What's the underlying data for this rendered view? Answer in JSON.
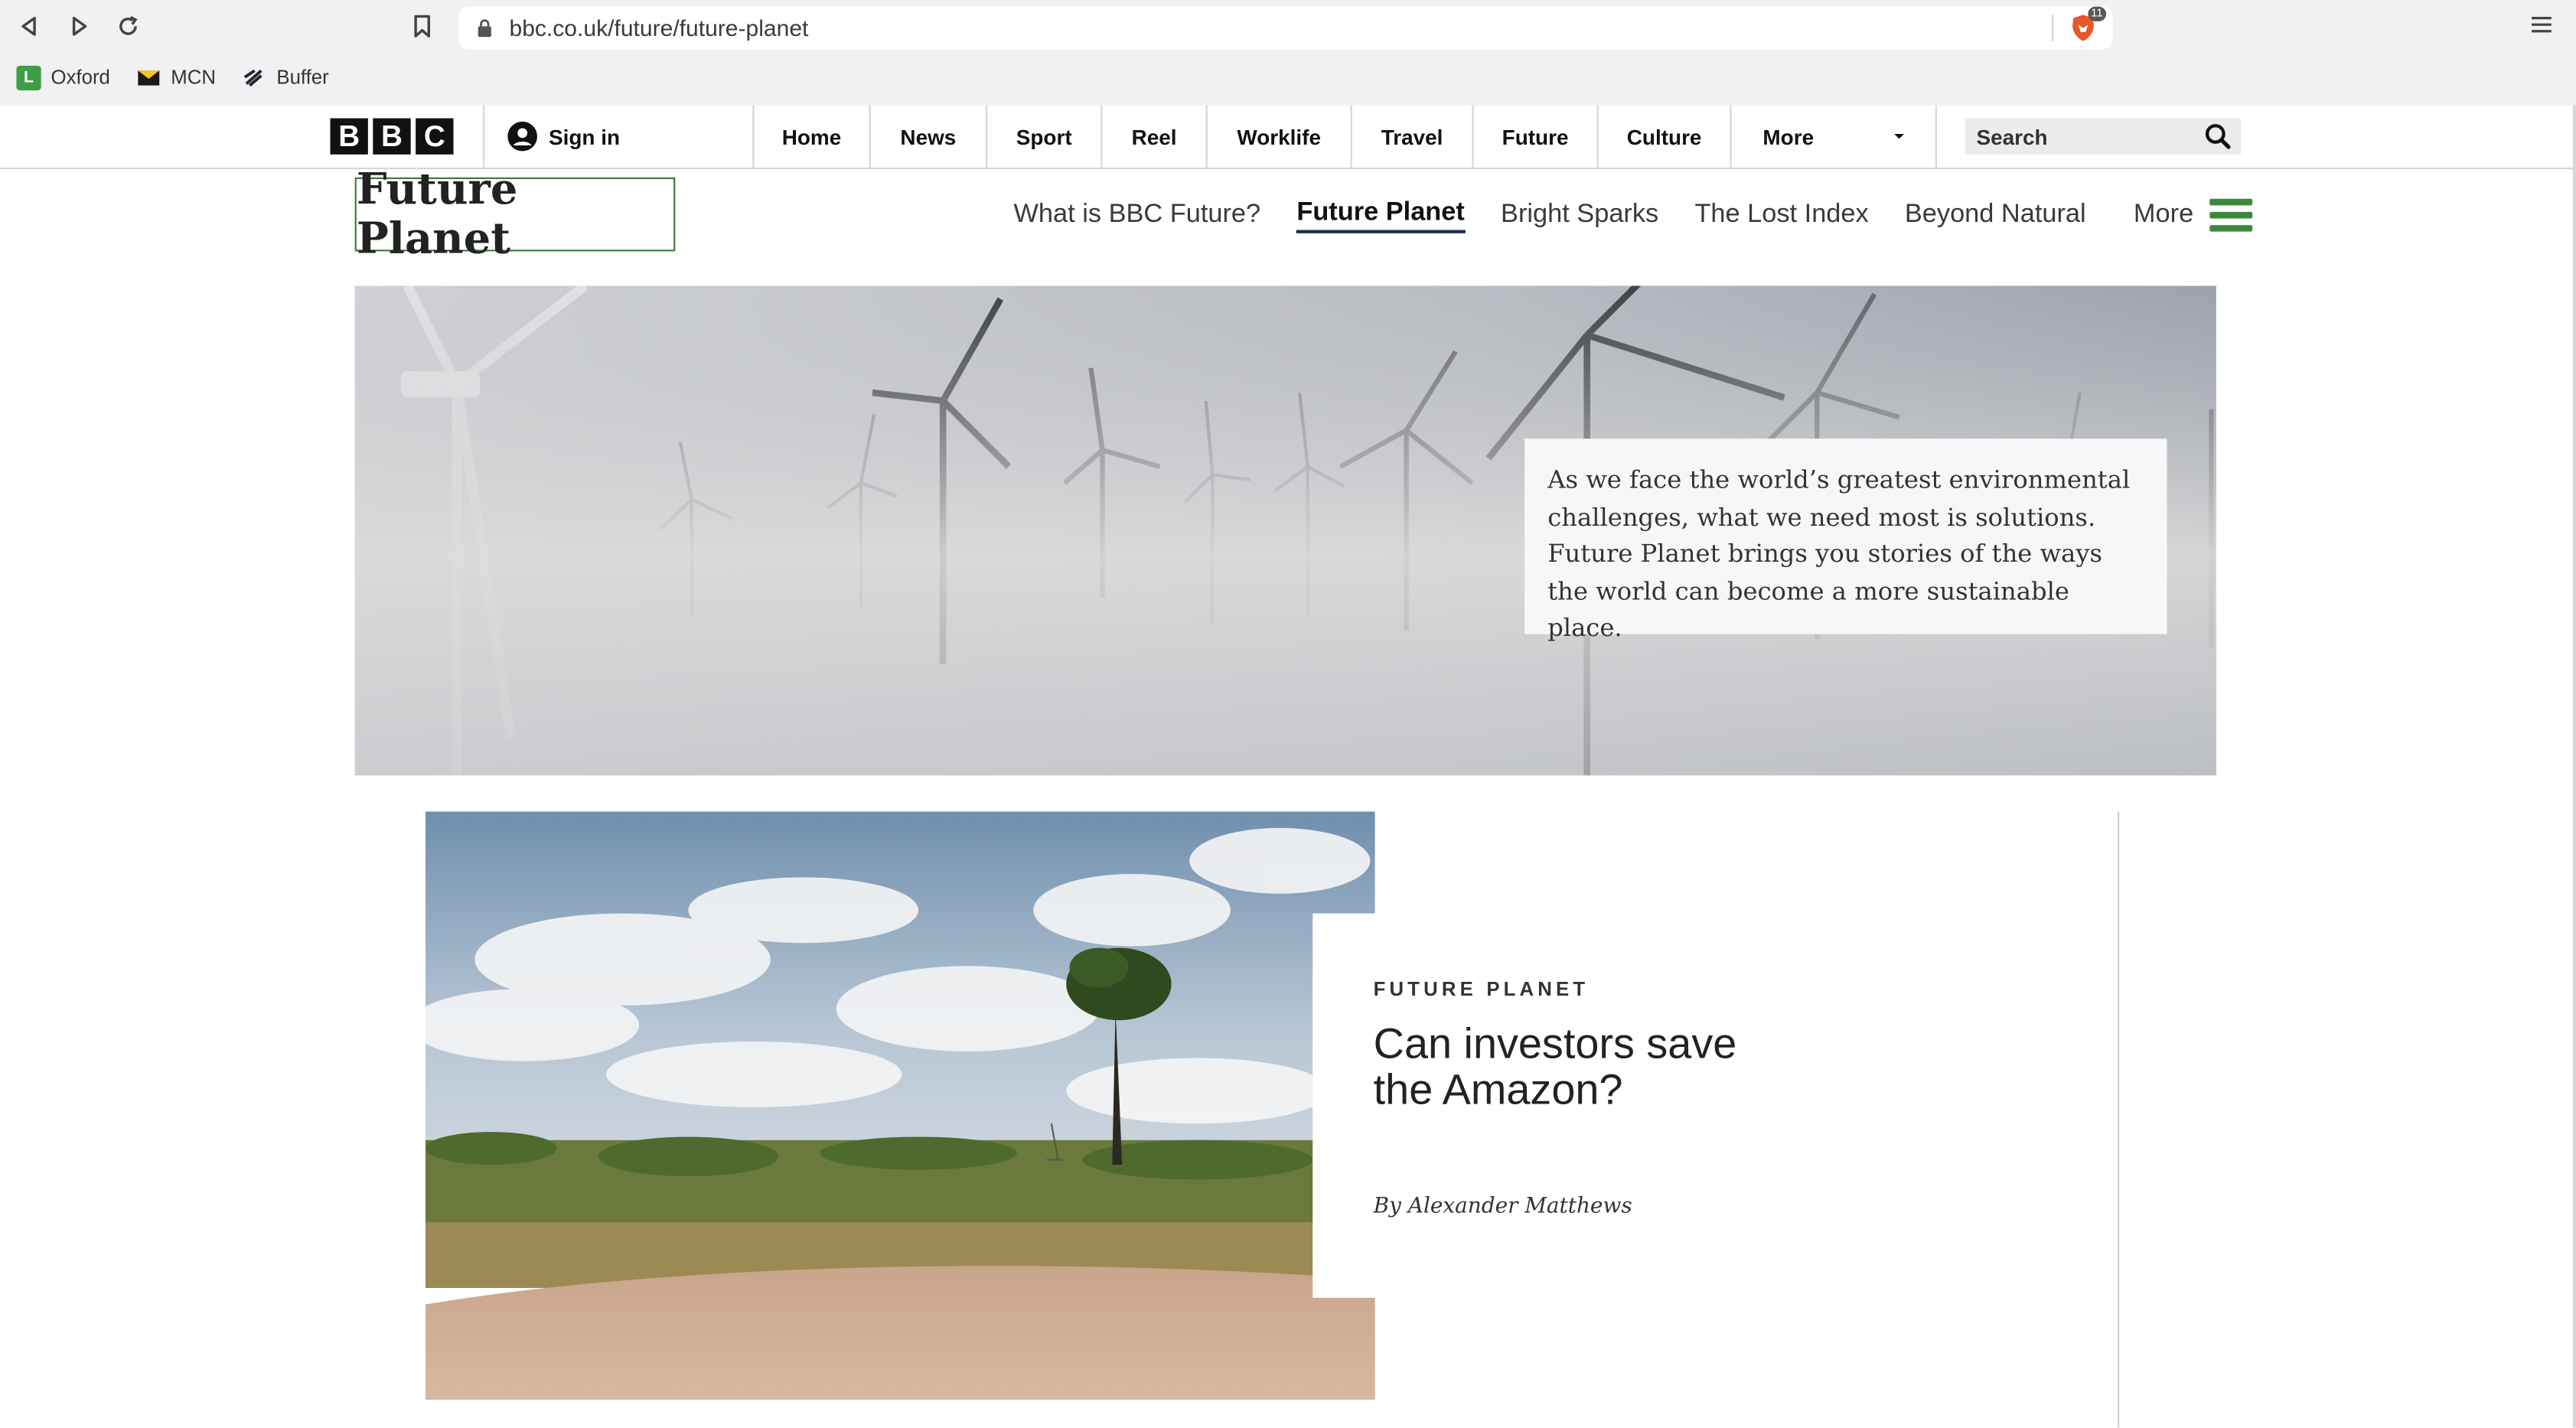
{
  "browser": {
    "url": "bbc.co.uk/future/future-planet",
    "brave_badge": "11",
    "bookmarks": [
      {
        "label": "Oxford",
        "icon": "oxford-favicon",
        "icon_letter": "L"
      },
      {
        "label": "MCN",
        "icon": "mcn-favicon"
      },
      {
        "label": "Buffer",
        "icon": "buffer-favicon"
      }
    ]
  },
  "bbc": {
    "logo_letters": [
      "B",
      "B",
      "C"
    ],
    "signin_label": "Sign in",
    "nav": [
      {
        "label": "Home"
      },
      {
        "label": "News"
      },
      {
        "label": "Sport"
      },
      {
        "label": "Reel"
      },
      {
        "label": "Worklife"
      },
      {
        "label": "Travel"
      },
      {
        "label": "Future"
      },
      {
        "label": "Culture"
      },
      {
        "label": "More"
      }
    ],
    "search_placeholder": "Search"
  },
  "section": {
    "title": "Future Planet",
    "subnav": [
      {
        "label": "What is BBC Future?"
      },
      {
        "label": "Future Planet",
        "active": true
      },
      {
        "label": "Bright Sparks"
      },
      {
        "label": "The Lost Index"
      },
      {
        "label": "Beyond Natural"
      }
    ],
    "more_label": "More",
    "accent_color": "#3b8a3b"
  },
  "hero": {
    "intro": "As we face the world’s greatest environmental challenges, what we need most is solutions. Future Planet brings you stories of the ways the world can become a more sustainable place."
  },
  "feature": {
    "kicker": "FUTURE PLANET",
    "headline": "Can investors save the Amazon?",
    "byline": "By Alexander Matthews"
  }
}
